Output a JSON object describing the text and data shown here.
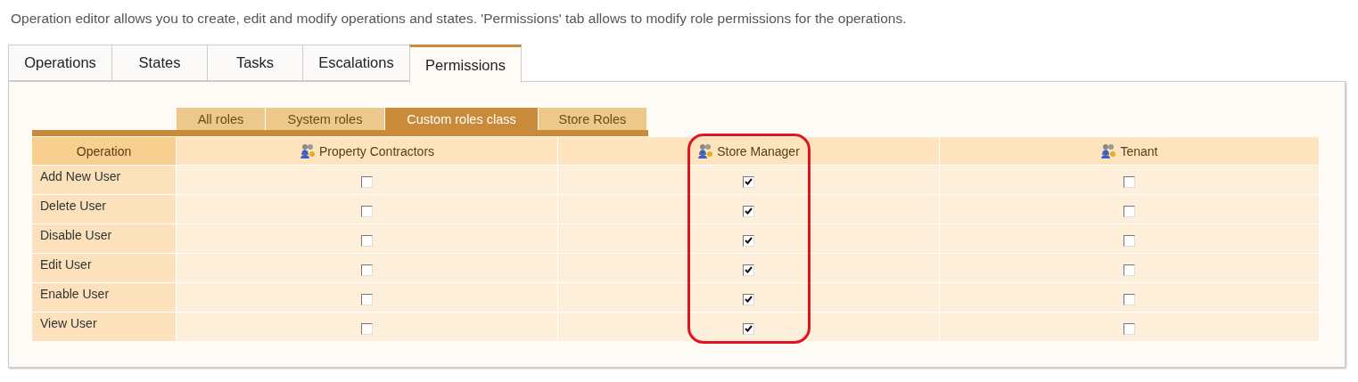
{
  "description": "Operation editor allows you to create, edit and modify operations and states. 'Permissions' tab allows to modify role permissions for the operations.",
  "tabs": [
    {
      "label": "Operations",
      "selected": false
    },
    {
      "label": "States",
      "selected": false
    },
    {
      "label": "Tasks",
      "selected": false
    },
    {
      "label": "Escalations",
      "selected": false
    },
    {
      "label": "Permissions",
      "selected": true
    }
  ],
  "role_tabs": [
    {
      "label": "All roles",
      "selected": false
    },
    {
      "label": "System roles",
      "selected": false
    },
    {
      "label": "Custom roles class",
      "selected": true
    },
    {
      "label": "Store Roles",
      "selected": false
    }
  ],
  "table": {
    "operation_header": "Operation",
    "columns": [
      {
        "name": "Property Contractors",
        "highlighted": false
      },
      {
        "name": "Store Manager",
        "highlighted": true
      },
      {
        "name": "Tenant",
        "highlighted": false
      }
    ],
    "rows": [
      {
        "operation": "Add New User",
        "permissions": [
          {
            "checked": false
          },
          {
            "checked": true
          },
          {
            "checked": false
          }
        ]
      },
      {
        "operation": "Delete User",
        "permissions": [
          {
            "checked": false
          },
          {
            "checked": true
          },
          {
            "checked": false
          }
        ]
      },
      {
        "operation": "Disable User",
        "permissions": [
          {
            "checked": false
          },
          {
            "checked": true
          },
          {
            "checked": false
          }
        ]
      },
      {
        "operation": "Edit User",
        "permissions": [
          {
            "checked": false
          },
          {
            "checked": true
          },
          {
            "checked": false
          }
        ]
      },
      {
        "operation": "Enable User",
        "permissions": [
          {
            "checked": false
          },
          {
            "checked": true
          },
          {
            "checked": false
          }
        ]
      },
      {
        "operation": "View User",
        "permissions": [
          {
            "checked": false
          },
          {
            "checked": true
          },
          {
            "checked": false
          }
        ]
      }
    ]
  }
}
